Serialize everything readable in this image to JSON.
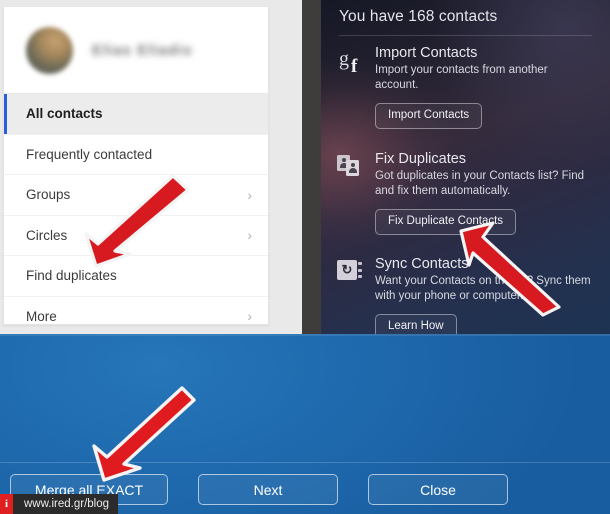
{
  "google_contacts": {
    "profile": {
      "name": "Elias Eliadis",
      "avatar_icon": "user-avatar-blurred"
    },
    "menu": [
      {
        "label": "All contacts",
        "selected": true,
        "chevron": false
      },
      {
        "label": "Frequently contacted",
        "selected": false,
        "chevron": false
      },
      {
        "label": "Groups",
        "selected": false,
        "chevron": true
      },
      {
        "label": "Circles",
        "selected": false,
        "chevron": true
      },
      {
        "label": "Find duplicates",
        "selected": false,
        "chevron": false
      },
      {
        "label": "More",
        "selected": false,
        "chevron": true
      }
    ],
    "chevron_glyph": "›"
  },
  "icloud_contacts": {
    "title": "You have 168 contacts",
    "contact_count": "168",
    "sections": [
      {
        "icon": "google-facebook-icon",
        "heading": "Import Contacts",
        "description": "Import your contacts from another account.",
        "button": "Import Contacts"
      },
      {
        "icon": "duplicate-cards-icon",
        "heading": "Fix Duplicates",
        "description": "Got duplicates in your Contacts list? Find and fix them automatically.",
        "button": "Fix Duplicate Contacts"
      },
      {
        "icon": "sync-addressbook-icon",
        "heading": "Sync Contacts",
        "description": "Want your Contacts on the go? Sync them with your phone or computer.",
        "button": "Learn How"
      }
    ],
    "icon_glyphs": {
      "google_g": "g",
      "facebook_f": "f",
      "sync_arrows": "↻"
    }
  },
  "merge_dialog": {
    "buttons": [
      {
        "label": "Merge all EXACT",
        "wide": true
      },
      {
        "label": "Next",
        "wide": false
      },
      {
        "label": "Close",
        "wide": false
      }
    ]
  },
  "watermark": {
    "badge": "i",
    "url": "www.ired.gr/blog"
  },
  "annotations": {
    "arrow_color": "#d71920",
    "arrow_outline": "#f2f2f2",
    "arrows": [
      {
        "name": "arrow-find-duplicates",
        "points_to": "Find duplicates"
      },
      {
        "name": "arrow-fix-duplicate-button",
        "points_to": "Fix Duplicate Contacts"
      },
      {
        "name": "arrow-merge-all-exact",
        "points_to": "Merge all EXACT"
      }
    ]
  },
  "theme": {
    "accent_blue": "#2b5fd9",
    "panel_blue": "#1f6aae",
    "dark_purple": "#2c2b44",
    "red": "#d71920"
  }
}
